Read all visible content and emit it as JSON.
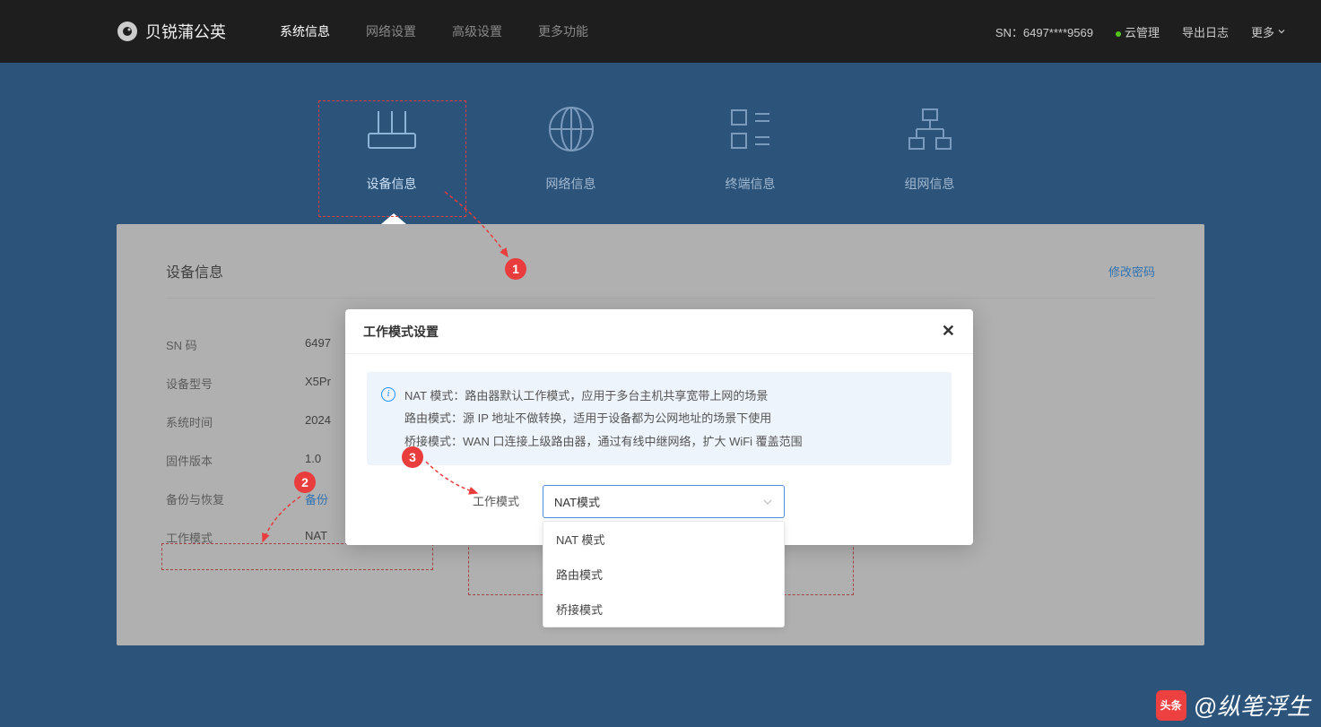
{
  "topbar": {
    "brand": "贝锐蒲公英",
    "nav": [
      "系统信息",
      "网络设置",
      "高级设置",
      "更多功能"
    ],
    "sn_label": "SN：",
    "sn_value": "6497****9569",
    "cloud": "云管理",
    "export_log": "导出日志",
    "more": "更多"
  },
  "cards": {
    "device": "设备信息",
    "network": "网络信息",
    "terminal": "终端信息",
    "group": "组网信息"
  },
  "panel": {
    "title": "设备信息",
    "change_pwd": "修改密码",
    "rows": {
      "sn_label": "SN 码",
      "sn_value": "6497",
      "model_label": "设备型号",
      "model_value": "X5Pr",
      "time_label": "系统时间",
      "time_value": "2024",
      "fw_label": "固件版本",
      "fw_value": "1.0",
      "backup_label": "备份与恢复",
      "backup_value": "备份",
      "mode_label": "工作模式",
      "mode_value": "NAT "
    }
  },
  "modal": {
    "title": "工作模式设置",
    "info_nat": "NAT 模式：路由器默认工作模式，应用于多台主机共享宽带上网的场景",
    "info_route": "路由模式：源 IP 地址不做转换，适用于设备都为公网地址的场景下使用",
    "info_bridge": "桥接模式：WAN 口连接上级路由器，通过有线中继网络，扩大 WiFi 覆盖范围",
    "form_label": "工作模式",
    "selected": "NAT模式",
    "options": [
      "NAT 模式",
      "路由模式",
      "桥接模式"
    ]
  },
  "badges": {
    "b1": "1",
    "b2": "2",
    "b3": "3"
  },
  "watermark": {
    "prefix": "头条",
    "author": "@纵笔浮生"
  }
}
